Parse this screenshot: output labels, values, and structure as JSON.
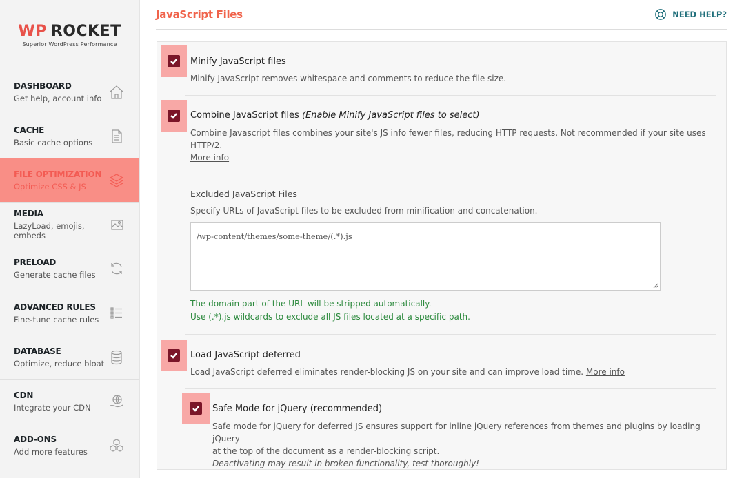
{
  "logo": {
    "wp": "WP",
    "rocket": "ROCKET",
    "tagline": "Superior WordPress Performance"
  },
  "nav": [
    {
      "title": "DASHBOARD",
      "sub": "Get help, account info"
    },
    {
      "title": "CACHE",
      "sub": "Basic cache options"
    },
    {
      "title": "FILE OPTIMIZATION",
      "sub": "Optimize CSS & JS"
    },
    {
      "title": "MEDIA",
      "sub": "LazyLoad, emojis, embeds"
    },
    {
      "title": "PRELOAD",
      "sub": "Generate cache files"
    },
    {
      "title": "ADVANCED RULES",
      "sub": "Fine-tune cache rules"
    },
    {
      "title": "DATABASE",
      "sub": "Optimize, reduce bloat"
    },
    {
      "title": "CDN",
      "sub": "Integrate your CDN"
    },
    {
      "title": "ADD-ONS",
      "sub": "Add more features"
    }
  ],
  "header": {
    "title": "JavaScript Files",
    "help": "NEED HELP?"
  },
  "options": {
    "minify": {
      "title": "Minify JavaScript files",
      "desc": "Minify JavaScript removes whitespace and comments to reduce the file size.",
      "checked": true
    },
    "combine": {
      "title": "Combine JavaScript files",
      "note": "(Enable Minify JavaScript files to select)",
      "desc": "Combine Javascript files combines your site's JS info fewer files, reducing HTTP requests. Not recommended if your site uses HTTP/2.",
      "more": "More info",
      "checked": true
    },
    "excluded": {
      "title": "Excluded JavaScript Files",
      "desc": "Specify URLs of JavaScript files to be excluded from minification and concatenation.",
      "value": "/wp-content/themes/some-theme/(.*).js",
      "hint1": "The domain part of the URL will be stripped automatically.",
      "hint2": "Use (.*).js wildcards to exclude all JS files located at a specific path."
    },
    "defer": {
      "title": "Load JavaScript deferred",
      "desc": "Load JavaScript deferred eliminates render-blocking JS on your site and can improve load time.",
      "more": "More info",
      "checked": true
    },
    "safe": {
      "title": "Safe Mode for jQuery (recommended)",
      "desc1": "Safe mode for jQuery for deferred JS ensures support for inline jQuery references from themes and plugins by loading jQuery",
      "desc2": "at the top of the document as a render-blocking script.",
      "warn": "Deactivating may result in broken functionality, test thoroughly!",
      "checked": true
    }
  },
  "colors": {
    "accent": "#f0634b",
    "active_bg": "#f98e86",
    "checkbox": "#7b1528",
    "checkbox_bg": "#f8a8a6",
    "help": "#1f6e7a",
    "hint": "#2d8a3e"
  }
}
